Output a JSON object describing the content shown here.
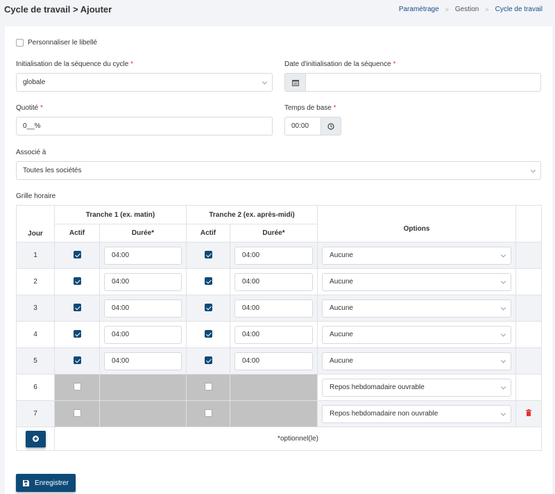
{
  "header": {
    "title": "Cycle de travail > Ajouter",
    "breadcrumb": [
      "Paramétrage",
      "Gestion",
      "Cycle de travail"
    ]
  },
  "form": {
    "custom_label_checkbox": "Personnaliser le libellé",
    "sequence_init": {
      "label": "Initialisation de la séquence du cycle",
      "value": "globale"
    },
    "sequence_date": {
      "label": "Date d'initialisation de la séquence",
      "value": ""
    },
    "quotite": {
      "label": "Quotité",
      "value": "0__%"
    },
    "base_time": {
      "label": "Temps de base",
      "value": "00:00"
    },
    "associated": {
      "label": "Associé à",
      "value": "Toutes les sociétés"
    },
    "required_mark": "*"
  },
  "grid": {
    "title": "Grille horaire",
    "headers": {
      "day": "Jour",
      "slot1": "Tranche 1 (ex. matin)",
      "slot2": "Tranche 2 (ex. après-midi)",
      "active": "Actif",
      "duration": "Durée*",
      "options": "Options"
    },
    "rows": [
      {
        "day": "1",
        "a1": true,
        "d1": "04:00",
        "a2": true,
        "d2": "04:00",
        "option": "Aucune",
        "enabled": true,
        "deletable": false
      },
      {
        "day": "2",
        "a1": true,
        "d1": "04:00",
        "a2": true,
        "d2": "04:00",
        "option": "Aucune",
        "enabled": true,
        "deletable": false
      },
      {
        "day": "3",
        "a1": true,
        "d1": "04:00",
        "a2": true,
        "d2": "04:00",
        "option": "Aucune",
        "enabled": true,
        "deletable": false
      },
      {
        "day": "4",
        "a1": true,
        "d1": "04:00",
        "a2": true,
        "d2": "04:00",
        "option": "Aucune",
        "enabled": true,
        "deletable": false
      },
      {
        "day": "5",
        "a1": true,
        "d1": "04:00",
        "a2": true,
        "d2": "04:00",
        "option": "Aucune",
        "enabled": true,
        "deletable": false
      },
      {
        "day": "6",
        "a1": false,
        "d1": "",
        "a2": false,
        "d2": "",
        "option": "Repos hebdomadaire ouvrable",
        "enabled": false,
        "deletable": false
      },
      {
        "day": "7",
        "a1": false,
        "d1": "",
        "a2": false,
        "d2": "",
        "option": "Repos hebdomadaire non ouvrable",
        "enabled": false,
        "deletable": true
      }
    ],
    "footnote": "*optionnel(le)"
  },
  "actions": {
    "save_label": "Enregistrer"
  },
  "colors": {
    "primary": "#0e4a78",
    "required": "#e3342f",
    "delete": "#e3342f",
    "disabled": "#c2c2c2"
  }
}
